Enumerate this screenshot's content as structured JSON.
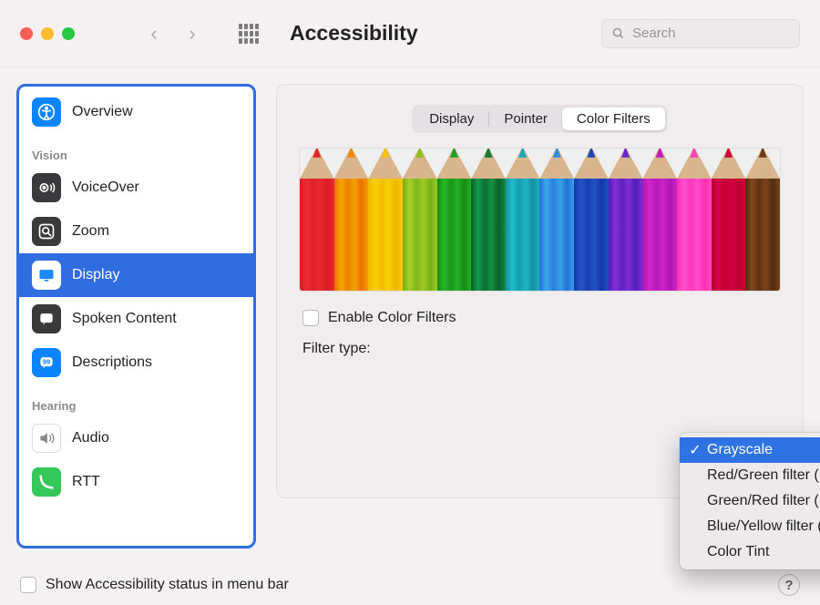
{
  "toolbar": {
    "title": "Accessibility",
    "search_placeholder": "Search"
  },
  "sidebar": {
    "top": {
      "overview": "Overview"
    },
    "vision": {
      "label": "Vision",
      "voiceover": "VoiceOver",
      "zoom": "Zoom",
      "display": "Display",
      "spoken": "Spoken Content",
      "descriptions": "Descriptions"
    },
    "hearing": {
      "label": "Hearing",
      "audio": "Audio",
      "rtt": "RTT"
    }
  },
  "tabs": {
    "display": "Display",
    "pointer": "Pointer",
    "color_filters": "Color Filters"
  },
  "pencil_colors": [
    "#e3242b",
    "#f08c00",
    "#f4c400",
    "#8dbf1f",
    "#1fa11f",
    "#0f7c3a",
    "#19a6b7",
    "#2f8de0",
    "#1c46b8",
    "#6a27c9",
    "#c01ec0",
    "#ff3fbf",
    "#c9003a",
    "#6b3a17"
  ],
  "filters": {
    "enable_label": "Enable Color Filters",
    "type_label": "Filter type:",
    "options": {
      "grayscale": "Grayscale",
      "protanopia": "Red/Green filter (Protanopia)",
      "deuteranopia": "Green/Red filter (Deuteranopia)",
      "tritanopia": "Blue/Yellow filter (Tritanopia)",
      "tint": "Color Tint"
    }
  },
  "bottom": {
    "status_label": "Show Accessibility status in menu bar"
  }
}
